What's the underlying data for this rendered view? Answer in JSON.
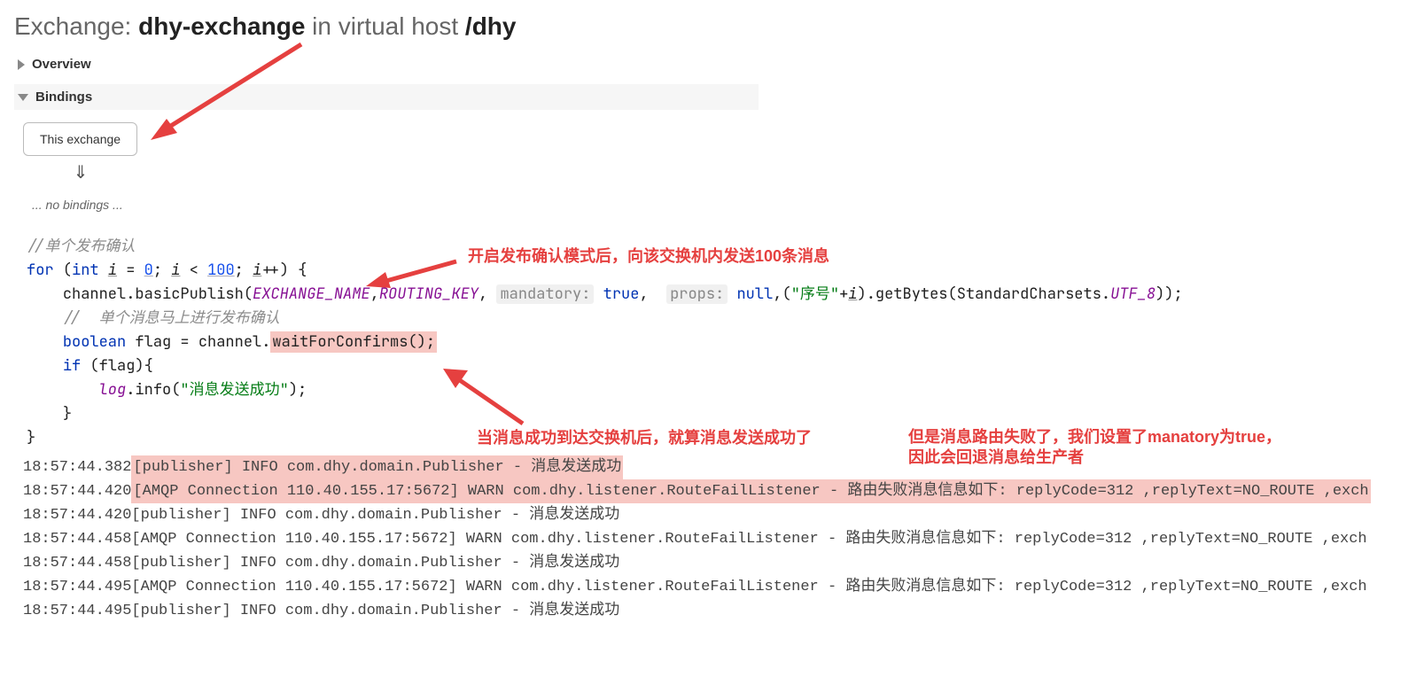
{
  "header": {
    "prefix": "Exchange: ",
    "name": "dhy-exchange",
    "middle": " in virtual host ",
    "vhost": "/dhy"
  },
  "sections": {
    "overview_title": "Overview",
    "bindings_title": "Bindings",
    "this_exchange_label": "This exchange",
    "down_arrow_glyph": "⇓",
    "no_bindings_text": "... no bindings ..."
  },
  "annotations": {
    "line1": "开启发布确认模式后，向该交换机内发送100条消息",
    "line2": "当消息成功到达交换机后，就算消息发送成功了",
    "line3a": "但是消息路由失败了，我们设置了manatory为true，",
    "line3b": "因此会回退消息给生产者"
  },
  "code": {
    "c_comment1": "//单个发布确认",
    "c_for": "for",
    "c_int": "int",
    "c_i": "i",
    "c_eq": " = ",
    "c_zero": "0",
    "c_semi": "; ",
    "c_lt": " < ",
    "c_hundred": "100",
    "c_inc": "++",
    "c_openbrace": ") {",
    "c_chan_publish": "channel.basicPublish(",
    "c_exname": "EXCHANGE_NAME",
    "c_comma": ",",
    "c_rkey": "ROUTING_KEY",
    "c_mandlbl": "mandatory:",
    "c_true": "true",
    "c_propslbl": "props:",
    "c_null": "null",
    "c_str1": "\"序号\"",
    "c_plus": "+",
    "c_getbytes": ").getBytes(StandardCharsets.",
    "c_utf8": "UTF_8",
    "c_endline": "));",
    "c_comment2": "//  单个消息马上进行发布确认",
    "c_bool": "boolean",
    "c_flag": " flag = channel.",
    "c_wait": "waitForConfirms();",
    "c_if": "if",
    "c_ifopen": " (flag){",
    "c_log": "log",
    "c_info": ".info(",
    "c_str2": "\"消息发送成功\"",
    "c_endlog": ");",
    "c_close1": "}",
    "c_close2": "}"
  },
  "logs": [
    {
      "t": "18:57:44.382",
      "highlighted": true,
      "hl_text": "[publisher] INFO com.dhy.domain.Publisher - 消息发送成功",
      "rest": ""
    },
    {
      "t": "18:57:44.420",
      "highlighted": true,
      "hl_text": "[AMQP Connection 110.40.155.17:5672] WARN com.dhy.listener.RouteFailListener - 路由失败消息信息如下: replyCode=312 ,replyText=NO_ROUTE ,exch",
      "rest": ""
    },
    {
      "t": "18:57:44.420",
      "highlighted": false,
      "rest": "[publisher] INFO com.dhy.domain.Publisher - 消息发送成功"
    },
    {
      "t": "18:57:44.458",
      "highlighted": false,
      "rest": "[AMQP Connection 110.40.155.17:5672] WARN com.dhy.listener.RouteFailListener - 路由失败消息信息如下: replyCode=312 ,replyText=NO_ROUTE ,exch"
    },
    {
      "t": "18:57:44.458",
      "highlighted": false,
      "rest": "[publisher] INFO com.dhy.domain.Publisher - 消息发送成功"
    },
    {
      "t": "18:57:44.495",
      "highlighted": false,
      "rest": "[AMQP Connection 110.40.155.17:5672] WARN com.dhy.listener.RouteFailListener - 路由失败消息信息如下: replyCode=312 ,replyText=NO_ROUTE ,exch"
    },
    {
      "t": "18:57:44.495",
      "highlighted": false,
      "rest": "[publisher] INFO com.dhy.domain.Publisher - 消息发送成功"
    }
  ]
}
